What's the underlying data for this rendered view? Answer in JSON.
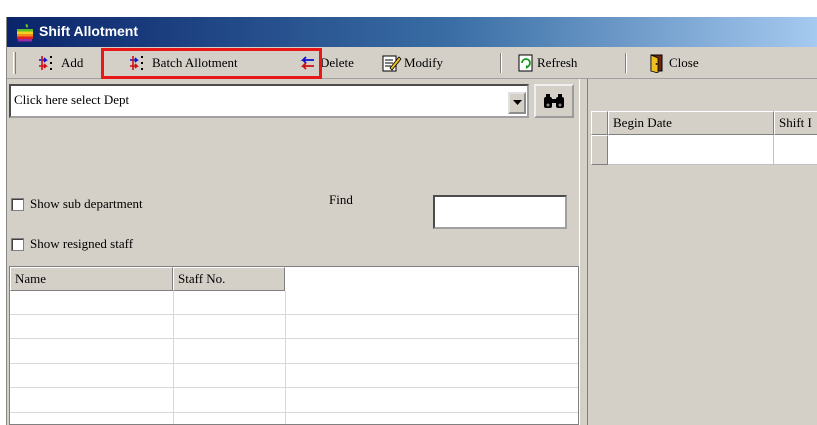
{
  "window": {
    "title": "Shift Allotment"
  },
  "toolbar": {
    "add_label": "Add",
    "batch_label": "Batch Allotment",
    "delete_label": "Delete",
    "modify_label": "Modify",
    "refresh_label": "Refresh",
    "close_label": "Close"
  },
  "dept": {
    "placeholder": "Click here select Dept"
  },
  "options": {
    "show_sub_department": "Show sub department",
    "show_resigned_staff": "Show resigned staff",
    "find_label": "Find"
  },
  "staff_grid": {
    "columns": [
      "Name",
      "Staff No."
    ]
  },
  "allot_grid": {
    "columns": [
      "Begin Date",
      "Shift I"
    ]
  }
}
